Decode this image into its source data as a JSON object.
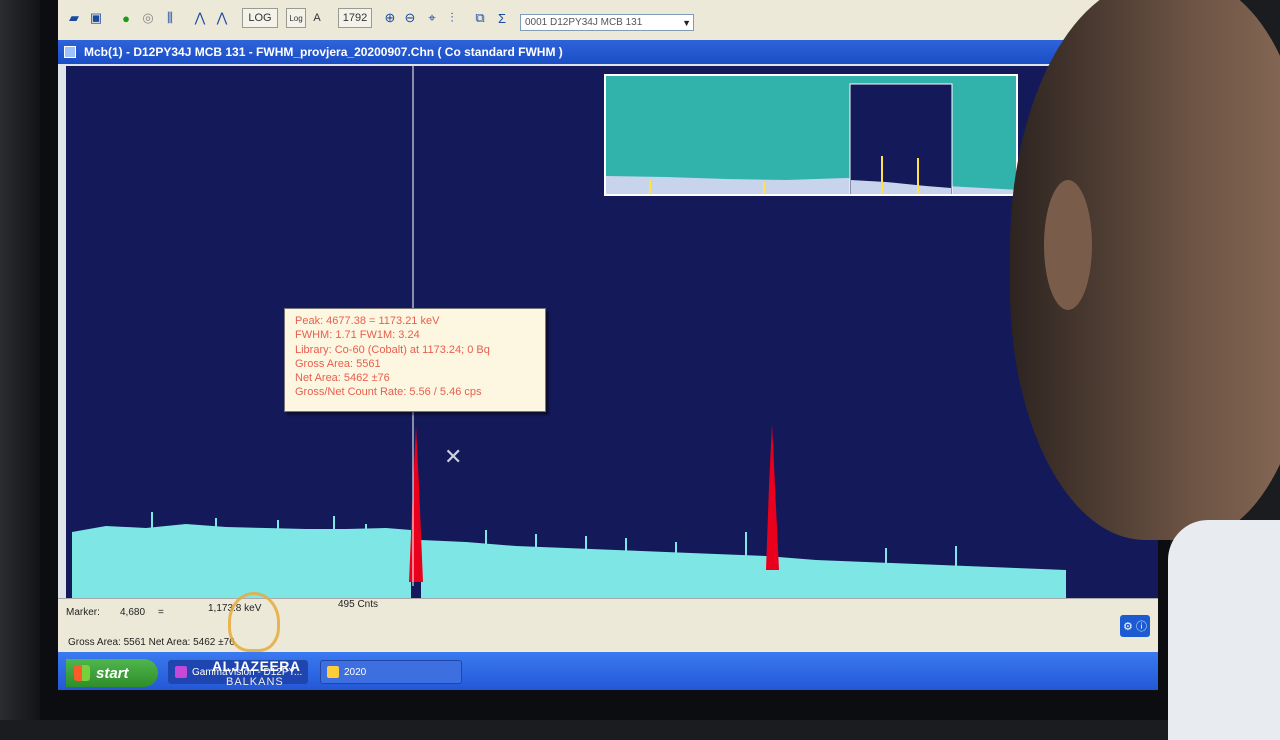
{
  "toolbar": {
    "log_label": "LOG",
    "lin_label": "Log",
    "auto_label": "A",
    "zoom_value": "1792",
    "detector_select": "0001  D12PY34J MCB 131"
  },
  "window": {
    "title": "Mcb(1) - D12PY34J MCB 131 - FWHM_provjera_20200907.Chn ( Co standard FWHM )"
  },
  "peak_info": {
    "line1": "Peak: 4677.38 = 1173.21 keV",
    "line2": "FWHM: 1.71  FW1M: 3.24",
    "line3": "Library: Co-60 (Cobalt) at 1173.24;  0 Bq",
    "line4": "Gross Area: 5561",
    "line5": "Net Area: 5462 ±76",
    "line6": "Gross/Net Count Rate: 5.56 / 5.46 cps"
  },
  "status": {
    "marker_label": "Marker:",
    "marker_channel": "4,680",
    "marker_eq": "=",
    "marker_energy": "1,173.8 keV",
    "counts": "495  Cnts",
    "area_line": "Gross Area: 5561  Net Area: 5462 ±76"
  },
  "taskbar": {
    "start_label": "start",
    "task1": "GammaVision - D12PY...",
    "task2": "2020"
  },
  "logo": {
    "name": "ALJAZEERA",
    "sub": "BALKANS"
  },
  "colors": {
    "spectrum_bg": "#14195a",
    "spectrum_fill": "#7fe6e6",
    "roi_peak": "#e8001c",
    "inset_bg": "#31b3ac",
    "tooltip_text": "#e75f4f"
  }
}
